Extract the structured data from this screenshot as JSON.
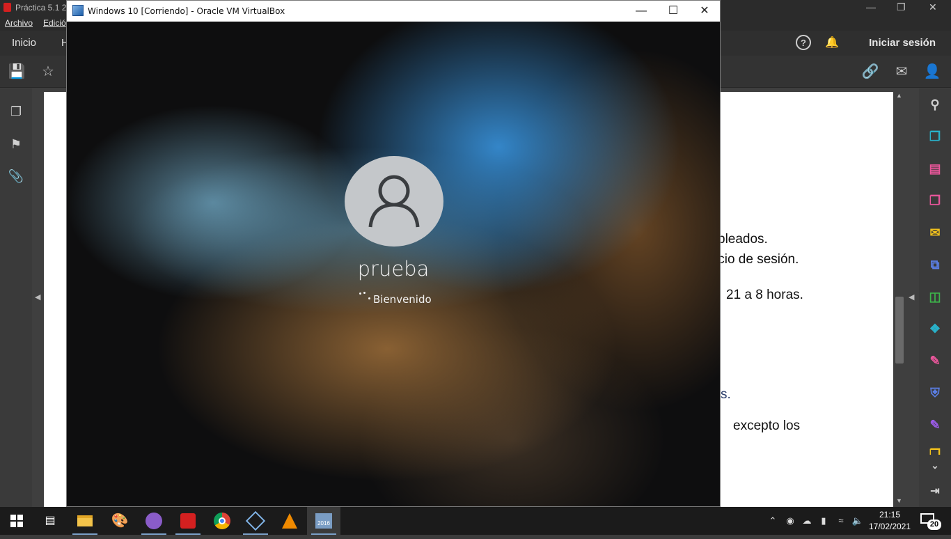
{
  "acrobat": {
    "title": "Práctica 5.1 2",
    "menu": [
      "Archivo",
      "Edició"
    ],
    "nav_tabs": [
      "Inicio",
      "H"
    ],
    "help_label": "?",
    "signin": "Iniciar sesión",
    "document_lines": [
      "pleados.",
      "icio de sesión.",
      "21  a  8  horas.",
      "s.",
      "excepto   los"
    ]
  },
  "virtualbox": {
    "window_title": "Windows 10 [Corriendo] - Oracle VM VirtualBox",
    "login": {
      "username": "prueba",
      "status": "Bienvenido"
    }
  },
  "taskbar": {
    "apps": [
      {
        "icon": "file-explorer-icon"
      },
      {
        "icon": "paint-icon"
      },
      {
        "icon": "github-desktop-icon"
      },
      {
        "icon": "acrobat-icon"
      },
      {
        "icon": "chrome-icon"
      },
      {
        "icon": "virtualbox-icon"
      },
      {
        "icon": "vlc-icon"
      },
      {
        "icon": "sql-server-2016-icon",
        "label": "2016"
      }
    ],
    "clock": {
      "time": "21:15",
      "date": "17/02/2021"
    },
    "notification_count": "20"
  },
  "colors": {
    "acrobat_bg": "#3f3f3f",
    "taskbar_bg": "#1b1b1b",
    "vm_accent_blue": "#368cd2"
  }
}
